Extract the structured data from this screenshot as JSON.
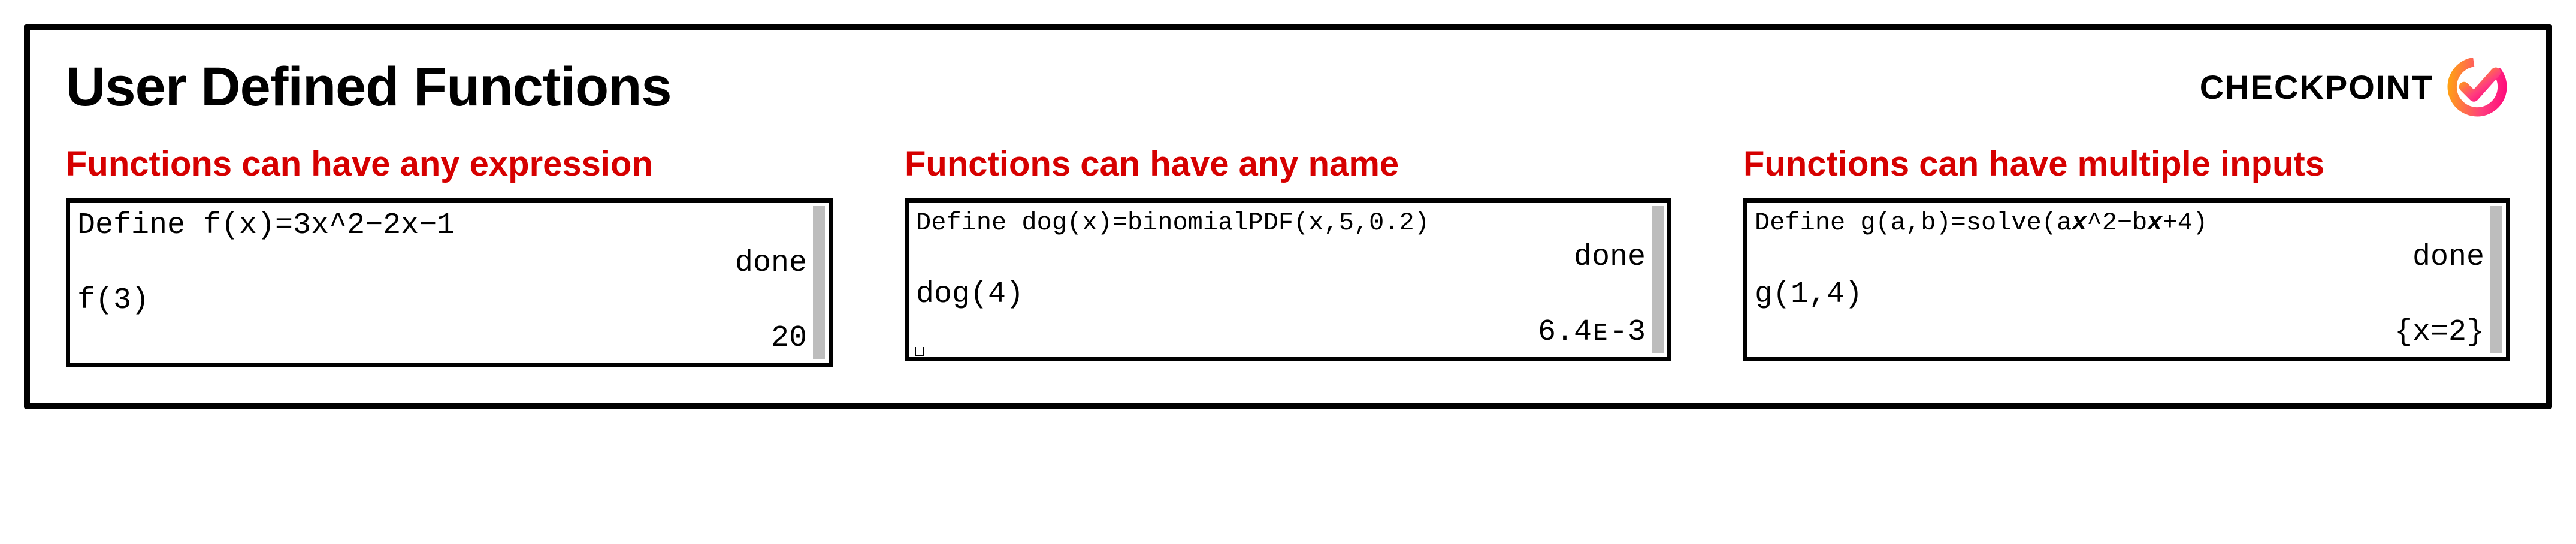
{
  "header": {
    "title": "User Defined Functions",
    "checkpoint_label": "CHECKPOINT"
  },
  "columns": [
    {
      "subtitle": "Functions can have any expression",
      "line1": "Define f(x)=3x^2−2x−1",
      "status1": "done",
      "line2": "f(3)",
      "result2": "20"
    },
    {
      "subtitle": "Functions can have any name",
      "line1": "Define dog(x)=binomialPDF(x,5,0.2)",
      "status1": "done",
      "line2": "dog(4)",
      "result2": "6.4ᴇ-3"
    },
    {
      "subtitle": "Functions can have multiple inputs",
      "line1_pre": "Define g(a,b)=solve(a",
      "line1_mid1": "x",
      "line1_inter": "^2−b",
      "line1_mid2": "x",
      "line1_post": "+4)",
      "status1": "done",
      "line2": "g(1,4)",
      "result2": "{x=2}"
    }
  ]
}
